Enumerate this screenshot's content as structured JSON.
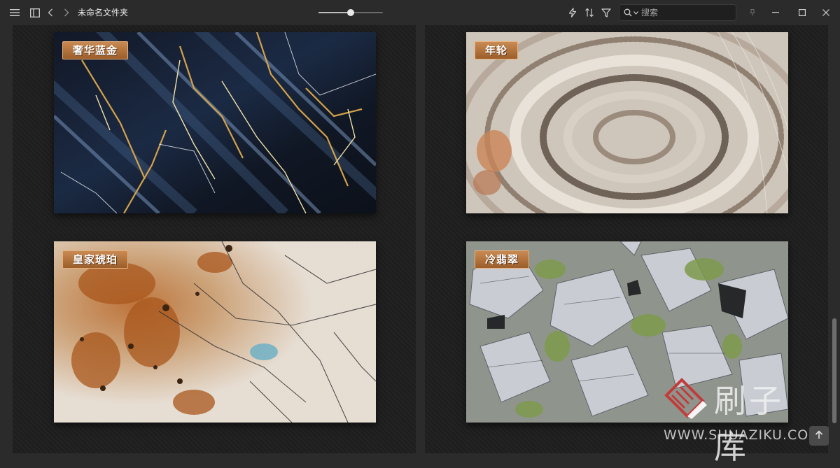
{
  "titlebar": {
    "title": "未命名文件夹",
    "search_placeholder": "搜索",
    "icons": {
      "menu": "menu-icon",
      "sidebar": "sidebar-icon",
      "back": "chevron-left-icon",
      "forward": "chevron-right-icon",
      "flash": "flash-icon",
      "sort": "sort-icon",
      "filter": "filter-icon",
      "search": "search-icon",
      "pin": "pin-icon",
      "minimize": "minimize-icon",
      "maximize": "maximize-icon",
      "close": "close-icon"
    },
    "zoom_fraction": 0.5
  },
  "tiles": [
    {
      "label": "奢华蓝金",
      "material": "dark-blue-gold-marble"
    },
    {
      "label": "年轮",
      "material": "onyx-rings-marble"
    },
    {
      "label": "皇家琥珀",
      "material": "white-amber-marble"
    },
    {
      "label": "冷翡翠",
      "material": "green-gray-breccia"
    }
  ],
  "watermark": {
    "cn": "刷子库",
    "en": "WWW.SHUAZIKU.COM"
  },
  "colors": {
    "background": "#2b2b2b",
    "page": "#1e1e1e",
    "label_gradient_top": "#c98a52",
    "label_gradient_bottom": "#9c5e2a"
  }
}
